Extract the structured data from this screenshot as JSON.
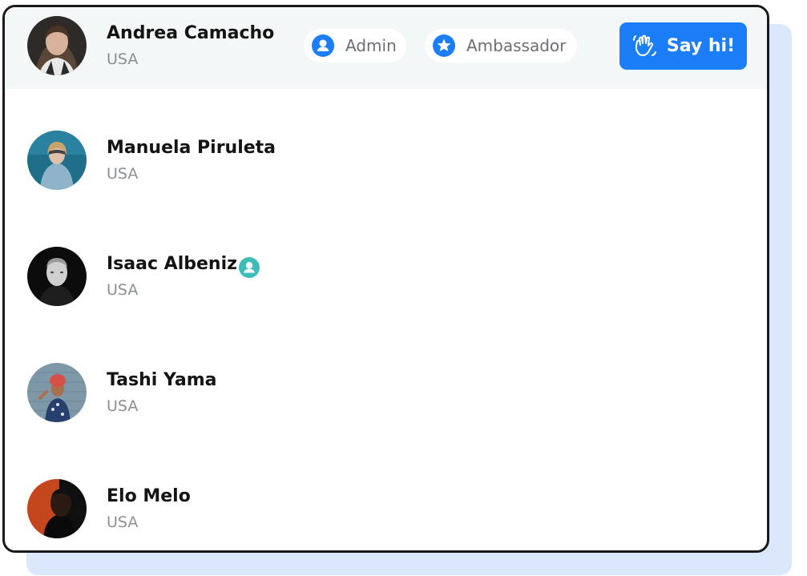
{
  "colors": {
    "accent": "#1b7ef7",
    "verified": "#3ebdb8",
    "highlight_row": "#f4f7f7",
    "shadow_card": "#dbe8fb"
  },
  "members": [
    {
      "name": "Andrea Camacho",
      "country": "USA",
      "avatar": "portrait-photo",
      "badges": [
        {
          "label": "Admin",
          "icon": "user-circle-icon"
        },
        {
          "label": "Ambassador",
          "icon": "star-circle-icon"
        }
      ],
      "action": {
        "label": "Say hi!",
        "icon": "waving-hand-icon"
      }
    },
    {
      "name": "Manuela Piruleta",
      "country": "USA",
      "avatar": "portrait-photo"
    },
    {
      "name": "Isaac Albeniz",
      "country": "USA",
      "avatar": "portrait-photo",
      "verified_icon": "user-circle-icon"
    },
    {
      "name": "Tashi Yama",
      "country": "USA",
      "avatar": "portrait-photo"
    },
    {
      "name": "Elo Melo",
      "country": "USA",
      "avatar": "portrait-photo"
    }
  ]
}
